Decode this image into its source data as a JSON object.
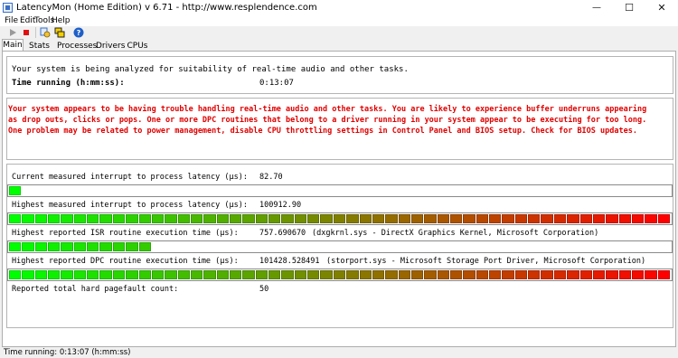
{
  "window": {
    "title": "LatencyMon  (Home Edition)  v 6.71 - http://www.resplendence.com",
    "minimize_glyph": "—",
    "maximize_glyph": "☐",
    "close_glyph": "✕"
  },
  "menu": {
    "items": [
      "File",
      "Edit",
      "Tools",
      "Help"
    ]
  },
  "toolbar": {
    "buttons": [
      {
        "name": "start-monitoring-button",
        "icon": "play-icon"
      },
      {
        "name": "stop-monitoring-button",
        "icon": "stop-icon"
      },
      {
        "name": "processes-drivers-button",
        "icon": "drivers-icon"
      },
      {
        "name": "windows-button",
        "icon": "windows-icon"
      },
      {
        "name": "help-button",
        "icon": "help-icon"
      }
    ]
  },
  "tabs": [
    "Main",
    "Stats",
    "Processes",
    "Drivers",
    "CPUs"
  ],
  "main": {
    "analyzing_text": "Your system is being analyzed for suitability of real-time audio and other tasks.",
    "time_running_label": "Time running (h:mm:ss):",
    "time_running_value": "0:13:07",
    "warning_lines": [
      "Your system appears to be having trouble handling real-time audio and other tasks. You are likely to experience buffer underruns appearing",
      "as drop outs, clicks or pops. One or more DPC routines that belong to a driver running in your system appear to be executing for too long.",
      "One problem may be related to power management, disable CPU throttling settings in Control Panel and BIOS setup. Check for BIOS updates."
    ],
    "warning_color": "#e00000",
    "metrics": [
      {
        "label": "Current measured interrupt to process latency (µs):",
        "value": "82.70",
        "detail": "",
        "level": 0.02
      },
      {
        "label": "Highest measured interrupt to process latency (µs):",
        "value": "100912.90",
        "detail": "",
        "level": 1.0
      },
      {
        "label": "Highest reported ISR routine execution time (µs):",
        "value": "757.690670",
        "detail": "(dxgkrnl.sys - DirectX Graphics Kernel, Microsoft Corporation)",
        "level": 0.22
      },
      {
        "label": "Highest reported DPC routine execution time (µs):",
        "value": "101428.528491",
        "detail": "(storport.sys - Microsoft Storage Port Driver, Microsoft Corporation)",
        "level": 1.0
      },
      {
        "label": "Reported total hard pagefault count:",
        "value": "50",
        "detail": "",
        "level": null
      }
    ]
  },
  "statusbar": {
    "text": "Time running: 0:13:07  (h:mm:ss)"
  },
  "colors": {
    "bar_start": "#00ff00",
    "bar_mid": "#808000",
    "bar_end": "#ff0000",
    "accent": "#3a6fc4"
  }
}
